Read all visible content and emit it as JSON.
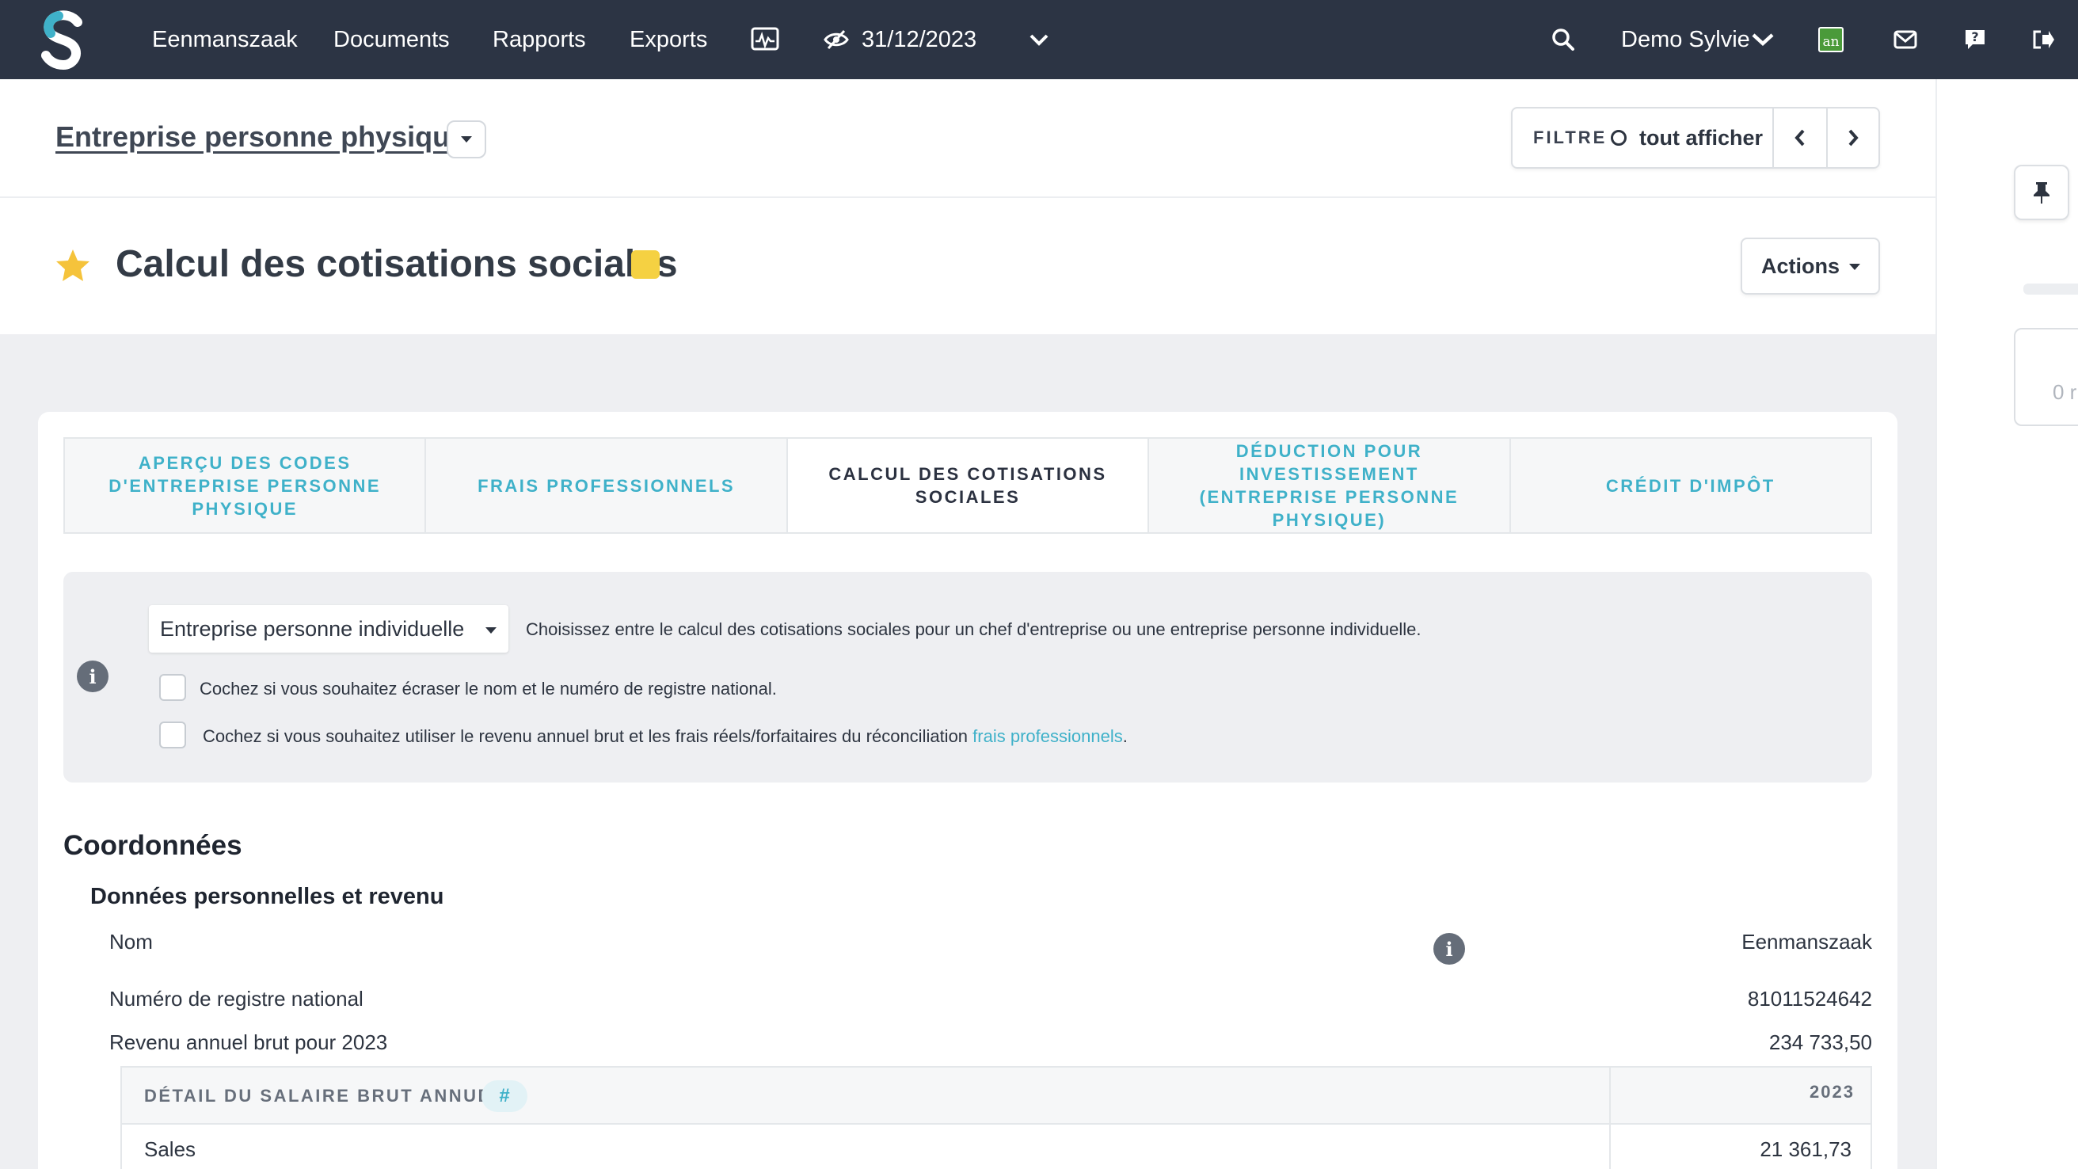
{
  "navbar": {
    "items": [
      "Eenmanszaak",
      "Documents",
      "Rapports",
      "Exports"
    ],
    "date": "31/12/2023",
    "user": "Demo Sylvie",
    "app_badge": "an",
    "bg_color": "#2c3444"
  },
  "header": {
    "breadcrumb": "Entreprise personne physique",
    "filter_label": "FILTRE",
    "filter_value": "tout afficher"
  },
  "title": {
    "text": "Calcul des cotisations sociales",
    "tag_color": "#f5d142",
    "star_color": "#f5c33b",
    "actions_label": "Actions"
  },
  "sidebar_right": {
    "partial_text": "0 r"
  },
  "tabs": [
    {
      "label": "APERÇU DES CODES D'ENTREPRISE PERSONNE PHYSIQUE",
      "active": false
    },
    {
      "label": "FRAIS PROFESSIONNELS",
      "active": false
    },
    {
      "label": "CALCUL DES COTISATIONS SOCIALES",
      "active": true
    },
    {
      "label": "DÉDUCTION POUR INVESTISSEMENT (ENTREPRISE PERSONNE PHYSIQUE)",
      "active": false
    },
    {
      "label": "CRÉDIT D'IMPÔT",
      "active": false
    }
  ],
  "info_panel": {
    "select_value": "Entreprise personne individuelle",
    "select_help": "Choisissez entre le calcul des cotisations sociales pour un chef d'entreprise ou une entreprise personne individuelle.",
    "checkbox1_label": "Cochez si vous souhaitez écraser le nom et le numéro de registre national.",
    "checkbox2_label_prefix": "Cochez si vous souhaitez utiliser le revenu annuel brut et les frais réels/forfaitaires du réconciliation ",
    "checkbox2_link": "frais professionnels",
    "checkbox2_label_suffix": ".",
    "accent_color": "#3fb1c9"
  },
  "coordonnees": {
    "section_title": "Coordonnées",
    "subsection_title": "Données personnelles et revenu",
    "rows": [
      {
        "label": "Nom",
        "value": "Eenmanszaak"
      },
      {
        "label": "Numéro de registre national",
        "value": "81011524642"
      },
      {
        "label": "Revenu annuel brut pour 2023",
        "value": "234 733,50"
      }
    ],
    "detail": {
      "title": "DÉTAIL DU SALAIRE BRUT ANNUEL",
      "badge": "#",
      "year": "2023",
      "row_label": "Sales",
      "row_value": "21 361,73"
    }
  }
}
